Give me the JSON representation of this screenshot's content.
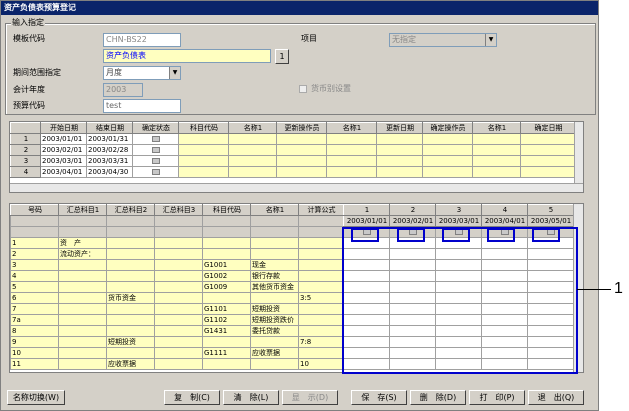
{
  "window": {
    "title": "资产负债表预算登记"
  },
  "form": {
    "group_label": "输入指定",
    "template_label": "模板代码",
    "template_value": "CHN-BS22",
    "template_name": "资产负债表",
    "lookup_btn": "1",
    "project_label": "项目",
    "project_value": "无指定",
    "period_label": "期间范围指定",
    "period_value": "月度",
    "year_label": "会计年度",
    "year_value": "2003",
    "currency_label": "货币别设置",
    "budget_label": "预算代码",
    "budget_value": "test"
  },
  "upper_table": {
    "headers": [
      "",
      "开始日期",
      "结束日期",
      "确定状态",
      "科目代码",
      "名称1",
      "更新操作员",
      "名称1",
      "更新日期",
      "确定操作员",
      "名称1",
      "确定日期"
    ],
    "rows": [
      {
        "n": "1",
        "s": "2003/01/01",
        "e": "2003/01/31"
      },
      {
        "n": "2",
        "s": "2003/02/01",
        "e": "2003/02/28"
      },
      {
        "n": "3",
        "s": "2003/03/01",
        "e": "2003/03/31"
      },
      {
        "n": "4",
        "s": "2003/04/01",
        "e": "2003/04/30"
      }
    ]
  },
  "lower_table": {
    "headers": [
      "号码",
      "汇总科目1",
      "汇总科目2",
      "汇总科目3",
      "科目代码",
      "名称1",
      "计算公式"
    ],
    "period_nums": [
      "1",
      "2",
      "3",
      "4",
      "5"
    ],
    "period_dates": [
      "2003/01/01",
      "2003/02/01",
      "2003/03/01",
      "2003/04/01",
      "2003/05/01"
    ],
    "rows": [
      {
        "n": "1",
        "a": "资　产",
        "b": "",
        "c": "",
        "code": "",
        "name": "",
        "f": ""
      },
      {
        "n": "2",
        "a": "流动资产：",
        "b": "",
        "c": "",
        "code": "",
        "name": "",
        "f": ""
      },
      {
        "n": "3",
        "a": "",
        "b": "",
        "c": "",
        "code": "G1001",
        "name": "现金",
        "f": ""
      },
      {
        "n": "4",
        "a": "",
        "b": "",
        "c": "",
        "code": "G1002",
        "name": "银行存款",
        "f": ""
      },
      {
        "n": "5",
        "a": "",
        "b": "",
        "c": "",
        "code": "G1009",
        "name": "其他货币资金",
        "f": ""
      },
      {
        "n": "6",
        "a": "",
        "b": "货币资金",
        "c": "",
        "code": "",
        "name": "",
        "f": "3:5"
      },
      {
        "n": "7",
        "a": "",
        "b": "",
        "c": "",
        "code": "G1101",
        "name": "短期投资",
        "f": ""
      },
      {
        "n": "7a",
        "a": "",
        "b": "",
        "c": "",
        "code": "G1102",
        "name": "短期投资跌价",
        "f": ""
      },
      {
        "n": "8",
        "a": "",
        "b": "",
        "c": "",
        "code": "G1431",
        "name": "委托贷款",
        "f": ""
      },
      {
        "n": "9",
        "a": "",
        "b": "短期投资",
        "c": "",
        "code": "",
        "name": "",
        "f": "7:8"
      },
      {
        "n": "10",
        "a": "",
        "b": "",
        "c": "",
        "code": "G1111",
        "name": "应收票据",
        "f": ""
      },
      {
        "n": "11",
        "a": "",
        "b": "应收票据",
        "c": "",
        "code": "",
        "name": "",
        "f": "10"
      }
    ]
  },
  "buttons": {
    "rename": "名称切换(W)",
    "copy": "复　制(C)",
    "clear": "清　除(L)",
    "show": "显　示(D)",
    "save": "保　存(S)",
    "delete": "删　除(D)",
    "print": "打　印(P)",
    "exit": "退　出(Q)"
  },
  "callout": {
    "label": "1"
  }
}
